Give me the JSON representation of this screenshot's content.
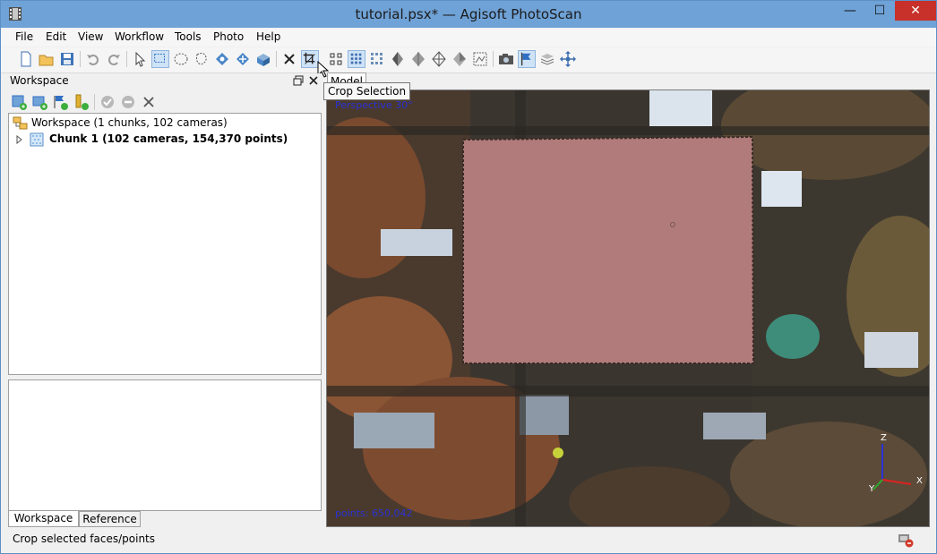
{
  "window": {
    "title": "tutorial.psx* — Agisoft PhotoScan",
    "minimize": "—",
    "maximize": "☐",
    "close": "✕"
  },
  "menu": [
    "File",
    "Edit",
    "View",
    "Workflow",
    "Tools",
    "Photo",
    "Help"
  ],
  "toolbar": {
    "icons": [
      "new-icon",
      "open-icon",
      "save-icon",
      "undo-icon",
      "redo-icon",
      "navigation-icon",
      "rectangle-selection-icon",
      "circle-selection-icon",
      "free-form-selection-icon",
      "rotate-object-icon",
      "move-object-icon",
      "resize-region-icon",
      "delete-selection-icon",
      "crop-selection-icon",
      "point-cloud-icon",
      "dense-cloud-icon",
      "shaded-icon",
      "solid-icon",
      "wireframe-icon",
      "textured-icon",
      "tiled-icon",
      "dem-icon",
      "show-cameras-icon",
      "show-markers-icon",
      "show-region-icon",
      "reset-view-icon"
    ],
    "tooltip": "Crop Selection"
  },
  "workspace": {
    "title": "Workspace",
    "tree_root": "Workspace (1 chunks, 102 cameras)",
    "chunk_label": "Chunk 1 (102 cameras, 154,370 points)",
    "tabs": [
      "Workspace",
      "Reference"
    ]
  },
  "model": {
    "tab_label": "Model",
    "top_label": "Perspective 30°",
    "points_label": "points: 650,042",
    "axes": {
      "z": "Z",
      "y": "Y",
      "x": "X"
    }
  },
  "status": "Crop selected faces/points",
  "colors": {
    "title_bar": "#6fa2d6",
    "selection_fill": "#b07b7a",
    "active_tool": "#cfe3f7",
    "label_blue": "#2a33d6"
  }
}
